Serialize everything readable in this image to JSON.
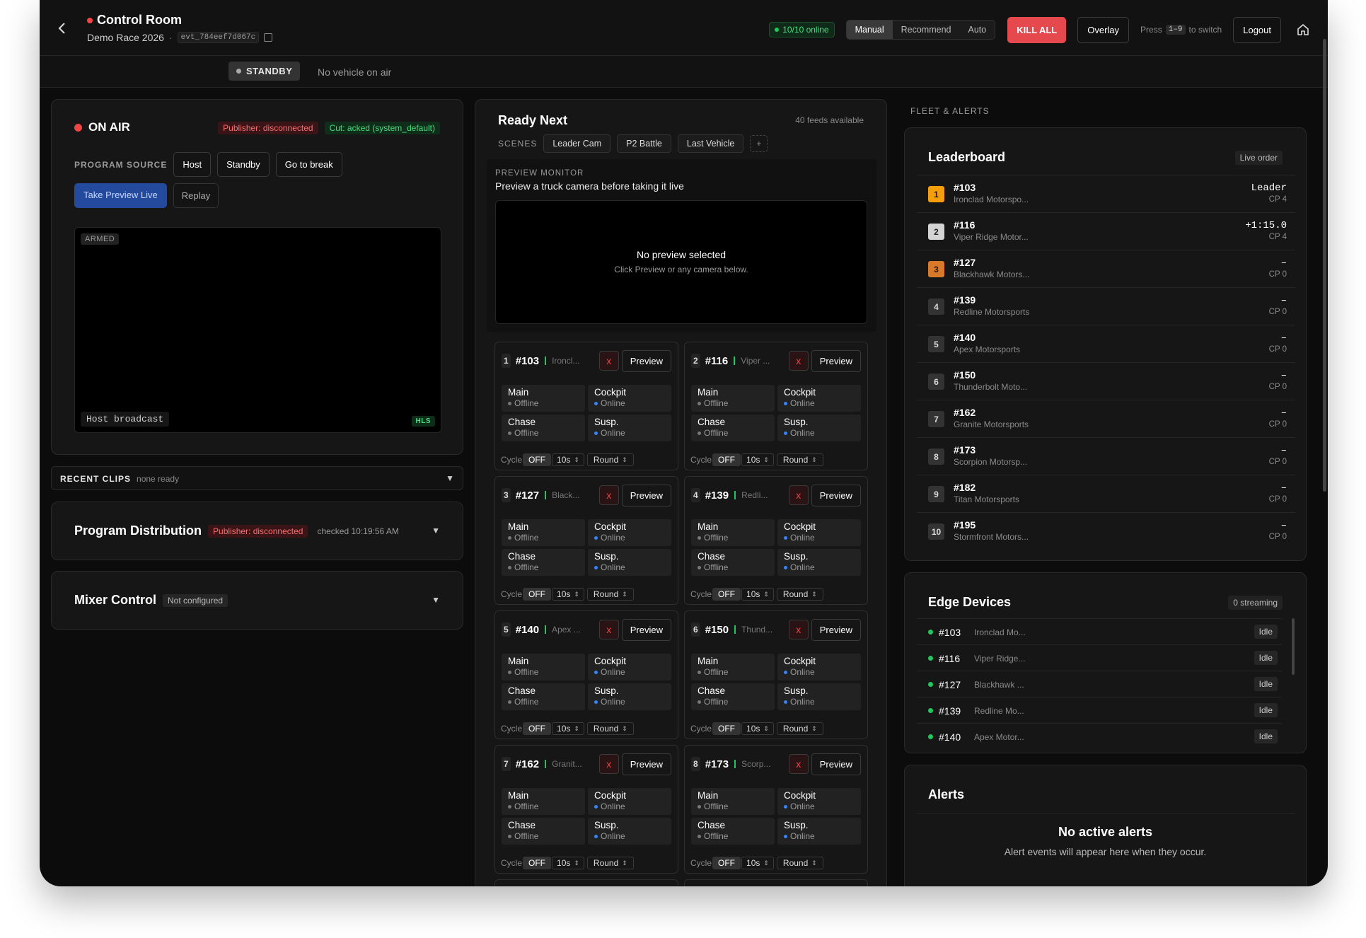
{
  "header": {
    "title": "Control Room",
    "event_name": "Demo Race 2026",
    "separator": "·",
    "event_id": "evt_784eef7d067c",
    "online": "10/10 online",
    "modes": [
      "Manual",
      "Recommend",
      "Auto"
    ],
    "active_mode": "Manual",
    "kill_all": "KILL ALL",
    "overlay": "Overlay",
    "press_prefix": "Press",
    "press_keys": "1–9",
    "press_suffix": "to switch",
    "logout": "Logout"
  },
  "status": {
    "standby": "STANDBY",
    "vehicle": "No vehicle on air"
  },
  "on_air": {
    "title": "ON AIR",
    "publisher": "Publisher: disconnected",
    "cut": "Cut: acked (system_default)",
    "program_source_label": "PROGRAM SOURCE",
    "sources": [
      "Host",
      "Standby",
      "Go to break"
    ],
    "take_preview": "Take Preview Live",
    "replay": "Replay",
    "armed": "ARMED",
    "host_broadcast": "Host broadcast",
    "stream_badge": "HLS"
  },
  "recent_clips": {
    "label": "RECENT CLIPS",
    "status": "none ready"
  },
  "program_distribution": {
    "title": "Program Distribution",
    "publisher": "Publisher: disconnected",
    "checked": "checked 10:19:56 AM"
  },
  "mixer": {
    "title": "Mixer Control",
    "status": "Not configured"
  },
  "ready_next": {
    "title": "Ready Next",
    "feeds": "40 feeds available",
    "scenes_label": "SCENES",
    "scenes": [
      "Leader Cam",
      "P2 Battle",
      "Last Vehicle"
    ],
    "add": "+",
    "preview_monitor_label": "PREVIEW MONITOR",
    "preview_monitor_sub": "Preview a truck camera before taking it live",
    "no_preview": "No preview selected",
    "no_preview_hint": "Click Preview or any camera below."
  },
  "tile_labels": {
    "close": "x",
    "preview": "Preview",
    "cycle": "Cycle",
    "cycle_state": "OFF",
    "interval": "10s",
    "mode": "Round",
    "cams": [
      "Main",
      "Cockpit",
      "Chase",
      "Susp."
    ],
    "offline": "Offline",
    "online": "Online"
  },
  "tiles": [
    {
      "rank": "1",
      "num": "#103",
      "name": "Ironcl..."
    },
    {
      "rank": "2",
      "num": "#116",
      "name": "Viper ..."
    },
    {
      "rank": "3",
      "num": "#127",
      "name": "Black..."
    },
    {
      "rank": "4",
      "num": "#139",
      "name": "Redli..."
    },
    {
      "rank": "5",
      "num": "#140",
      "name": "Apex ..."
    },
    {
      "rank": "6",
      "num": "#150",
      "name": "Thund..."
    },
    {
      "rank": "7",
      "num": "#162",
      "name": "Granit..."
    },
    {
      "rank": "8",
      "num": "#173",
      "name": "Scorp..."
    }
  ],
  "fleet": {
    "label": "FLEET & ALERTS",
    "leaderboard_title": "Leaderboard",
    "live_order": "Live order",
    "rows": [
      {
        "rank": "1",
        "num": "#103",
        "team": "Ironclad Motorspo...",
        "gap": "Leader",
        "cp": "CP 4"
      },
      {
        "rank": "2",
        "num": "#116",
        "team": "Viper Ridge Motor...",
        "gap": "+1:15.0",
        "cp": "CP 4"
      },
      {
        "rank": "3",
        "num": "#127",
        "team": "Blackhawk Motors...",
        "gap": "–",
        "cp": "CP 0"
      },
      {
        "rank": "4",
        "num": "#139",
        "team": "Redline Motorsports",
        "gap": "–",
        "cp": "CP 0"
      },
      {
        "rank": "5",
        "num": "#140",
        "team": "Apex Motorsports",
        "gap": "–",
        "cp": "CP 0"
      },
      {
        "rank": "6",
        "num": "#150",
        "team": "Thunderbolt Moto...",
        "gap": "–",
        "cp": "CP 0"
      },
      {
        "rank": "7",
        "num": "#162",
        "team": "Granite Motorsports",
        "gap": "–",
        "cp": "CP 0"
      },
      {
        "rank": "8",
        "num": "#173",
        "team": "Scorpion Motorsp...",
        "gap": "–",
        "cp": "CP 0"
      },
      {
        "rank": "9",
        "num": "#182",
        "team": "Titan Motorsports",
        "gap": "–",
        "cp": "CP 0"
      },
      {
        "rank": "10",
        "num": "#195",
        "team": "Stormfront Motors...",
        "gap": "–",
        "cp": "CP 0"
      }
    ],
    "edge_title": "Edge Devices",
    "edge_streaming": "0 streaming",
    "edge_rows": [
      {
        "num": "#103",
        "name": "Ironclad Mo...",
        "state": "Idle"
      },
      {
        "num": "#116",
        "name": "Viper Ridge...",
        "state": "Idle"
      },
      {
        "num": "#127",
        "name": "Blackhawk ...",
        "state": "Idle"
      },
      {
        "num": "#139",
        "name": "Redline Mo...",
        "state": "Idle"
      },
      {
        "num": "#140",
        "name": "Apex Motor...",
        "state": "Idle"
      }
    ],
    "alerts_title": "Alerts",
    "no_alerts": "No active alerts",
    "no_alerts_hint": "Alert events will appear here when they occur."
  },
  "colors": {
    "accent_red": "#e5484d",
    "online_green": "#22c55e",
    "blue": "#234a9c"
  }
}
